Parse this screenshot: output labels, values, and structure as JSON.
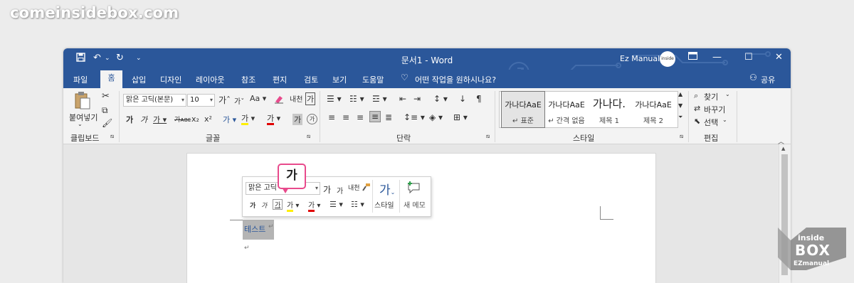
{
  "watermark": "comeinsidebox.com",
  "app": {
    "title": "문서1  -  Word",
    "user_name": "Ez Manual",
    "avatar_text": "inside"
  },
  "tabs": [
    {
      "label": "파일"
    },
    {
      "label": "홈"
    },
    {
      "label": "삽입"
    },
    {
      "label": "디자인"
    },
    {
      "label": "레이아웃"
    },
    {
      "label": "참조"
    },
    {
      "label": "편지"
    },
    {
      "label": "검토"
    },
    {
      "label": "보기"
    },
    {
      "label": "도움말"
    }
  ],
  "tell_me": "어떤 작업을 원하시나요?",
  "share": "공유",
  "ribbon": {
    "clipboard": {
      "paste": "붙여넣기",
      "label": "클립보드"
    },
    "font": {
      "name": "맑은 고딕(본문)",
      "size": "10",
      "label": "글꼴"
    },
    "paragraph": {
      "label": "단락"
    },
    "styles": {
      "label": "스타일",
      "items": [
        {
          "sample": "가나다AaE",
          "name": "↵ 표준"
        },
        {
          "sample": "가나다AaE",
          "name": "↵ 간격 없음"
        },
        {
          "sample": "가나다.",
          "name": "제목 1"
        },
        {
          "sample": "가나다AaE",
          "name": "제목 2"
        }
      ]
    },
    "editing": {
      "find": "찾기",
      "replace": "바꾸기",
      "select": "선택",
      "label": "편집"
    }
  },
  "mini_toolbar": {
    "font": "맑은 고딕",
    "styles": "스타일",
    "new_comment": "새 메모"
  },
  "callout_glyph": "가",
  "document": {
    "line1": "테스트",
    "paragraph_mark": "↵"
  },
  "logo": {
    "line1": "inside",
    "line2": "BOX",
    "line3": "EZmanual"
  },
  "colors": {
    "accent": "#2b579a",
    "highlight": "#e84a8c"
  }
}
